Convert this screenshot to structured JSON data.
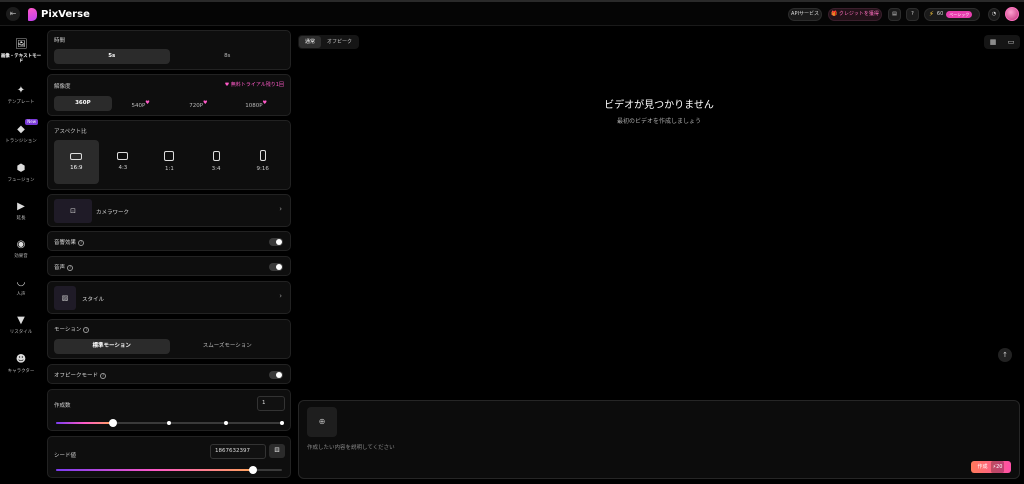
{
  "app": {
    "name": "PixVerse"
  },
  "topbar": {
    "api_label": "APIサービス",
    "credit_label": "クレジットを獲得",
    "credits": "60",
    "plan_badge": "ベーシック"
  },
  "nav": {
    "items": [
      {
        "label": "画像・テキストモード",
        "icon": "image-icon"
      },
      {
        "label": "テンプレート",
        "icon": "sparkle-icon"
      },
      {
        "label": "トランジション",
        "icon": "diamond-icon",
        "badge": "New"
      },
      {
        "label": "フュージョン",
        "icon": "cube-icon"
      },
      {
        "label": "延長",
        "icon": "video-extend-icon"
      },
      {
        "label": "効果音",
        "icon": "sound-icon"
      },
      {
        "label": "人声",
        "icon": "lips-icon"
      },
      {
        "label": "リスタイル",
        "icon": "brush-icon"
      },
      {
        "label": "キャラクター",
        "icon": "character-icon"
      }
    ]
  },
  "settings": {
    "duration": {
      "title": "時間",
      "options": [
        "5s",
        "8s"
      ],
      "selected": "5s"
    },
    "resolution": {
      "title": "解像度",
      "trial": "無料トライアル残り1回",
      "options": [
        "360P",
        "540P",
        "720P",
        "1080P"
      ],
      "selected": "360P"
    },
    "aspect": {
      "title": "アスペクト比",
      "options": [
        "16:9",
        "4:3",
        "1:1",
        "3:4",
        "9:16"
      ],
      "selected": "16:9"
    },
    "camera": {
      "label": "カメラワーク"
    },
    "sfx": {
      "label": "音響効果",
      "on": false
    },
    "voice": {
      "label": "音声",
      "on": false
    },
    "style": {
      "label": "スタイル"
    },
    "motion": {
      "title": "モーション",
      "options": [
        "標準モーション",
        "スムーズモーション"
      ],
      "selected": "標準モーション"
    },
    "offpeak_mode": {
      "label": "オフピークモード",
      "on": false
    },
    "count": {
      "title": "作成数",
      "value": "1",
      "slider_steps": 4,
      "slider_index": 0
    },
    "seed": {
      "title": "シード値",
      "value": "1867632397",
      "slider_fraction": 0.87
    }
  },
  "main": {
    "tabs": [
      "通常",
      "オフピーク"
    ],
    "selected_tab": "通常",
    "empty_title": "ビデオが見つかりません",
    "empty_sub": "最初のビデオを作成しましょう",
    "prompt_placeholder": "作成したい内容を説明してください",
    "create_label": "作成",
    "create_cost": "20"
  },
  "colors": {
    "accent": "#ff5ac8",
    "accent2": "#7b3cf0",
    "bg": "#000000"
  }
}
